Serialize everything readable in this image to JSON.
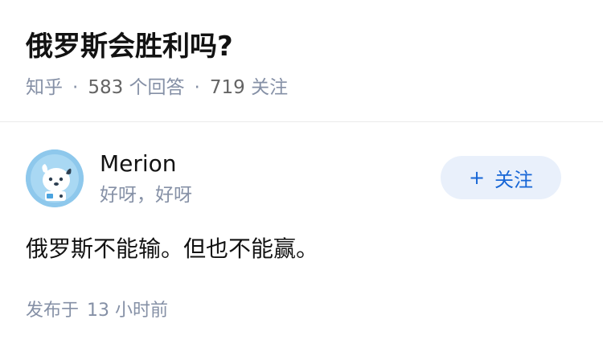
{
  "question": {
    "title": "俄罗斯会胜利吗?",
    "source": "知乎",
    "separator": "·",
    "answer_count": "583",
    "answer_label": "个回答",
    "follower_count": "719",
    "follower_label": "关注"
  },
  "author": {
    "name": "Merion",
    "bio": "好呀，好呀",
    "avatar_icon": "dog-avatar-icon"
  },
  "follow_button": {
    "plus": "+",
    "label": "关注"
  },
  "answer": {
    "text": "俄罗斯不能输。但也不能赢。",
    "posted_label": "发布于",
    "posted_time": "13 小时前"
  },
  "colors": {
    "accent": "#1766d6",
    "accent_bg": "#e9f0fb",
    "meta": "#8590a6",
    "text": "#121212",
    "avatar_bg": "#8ec8ec"
  }
}
